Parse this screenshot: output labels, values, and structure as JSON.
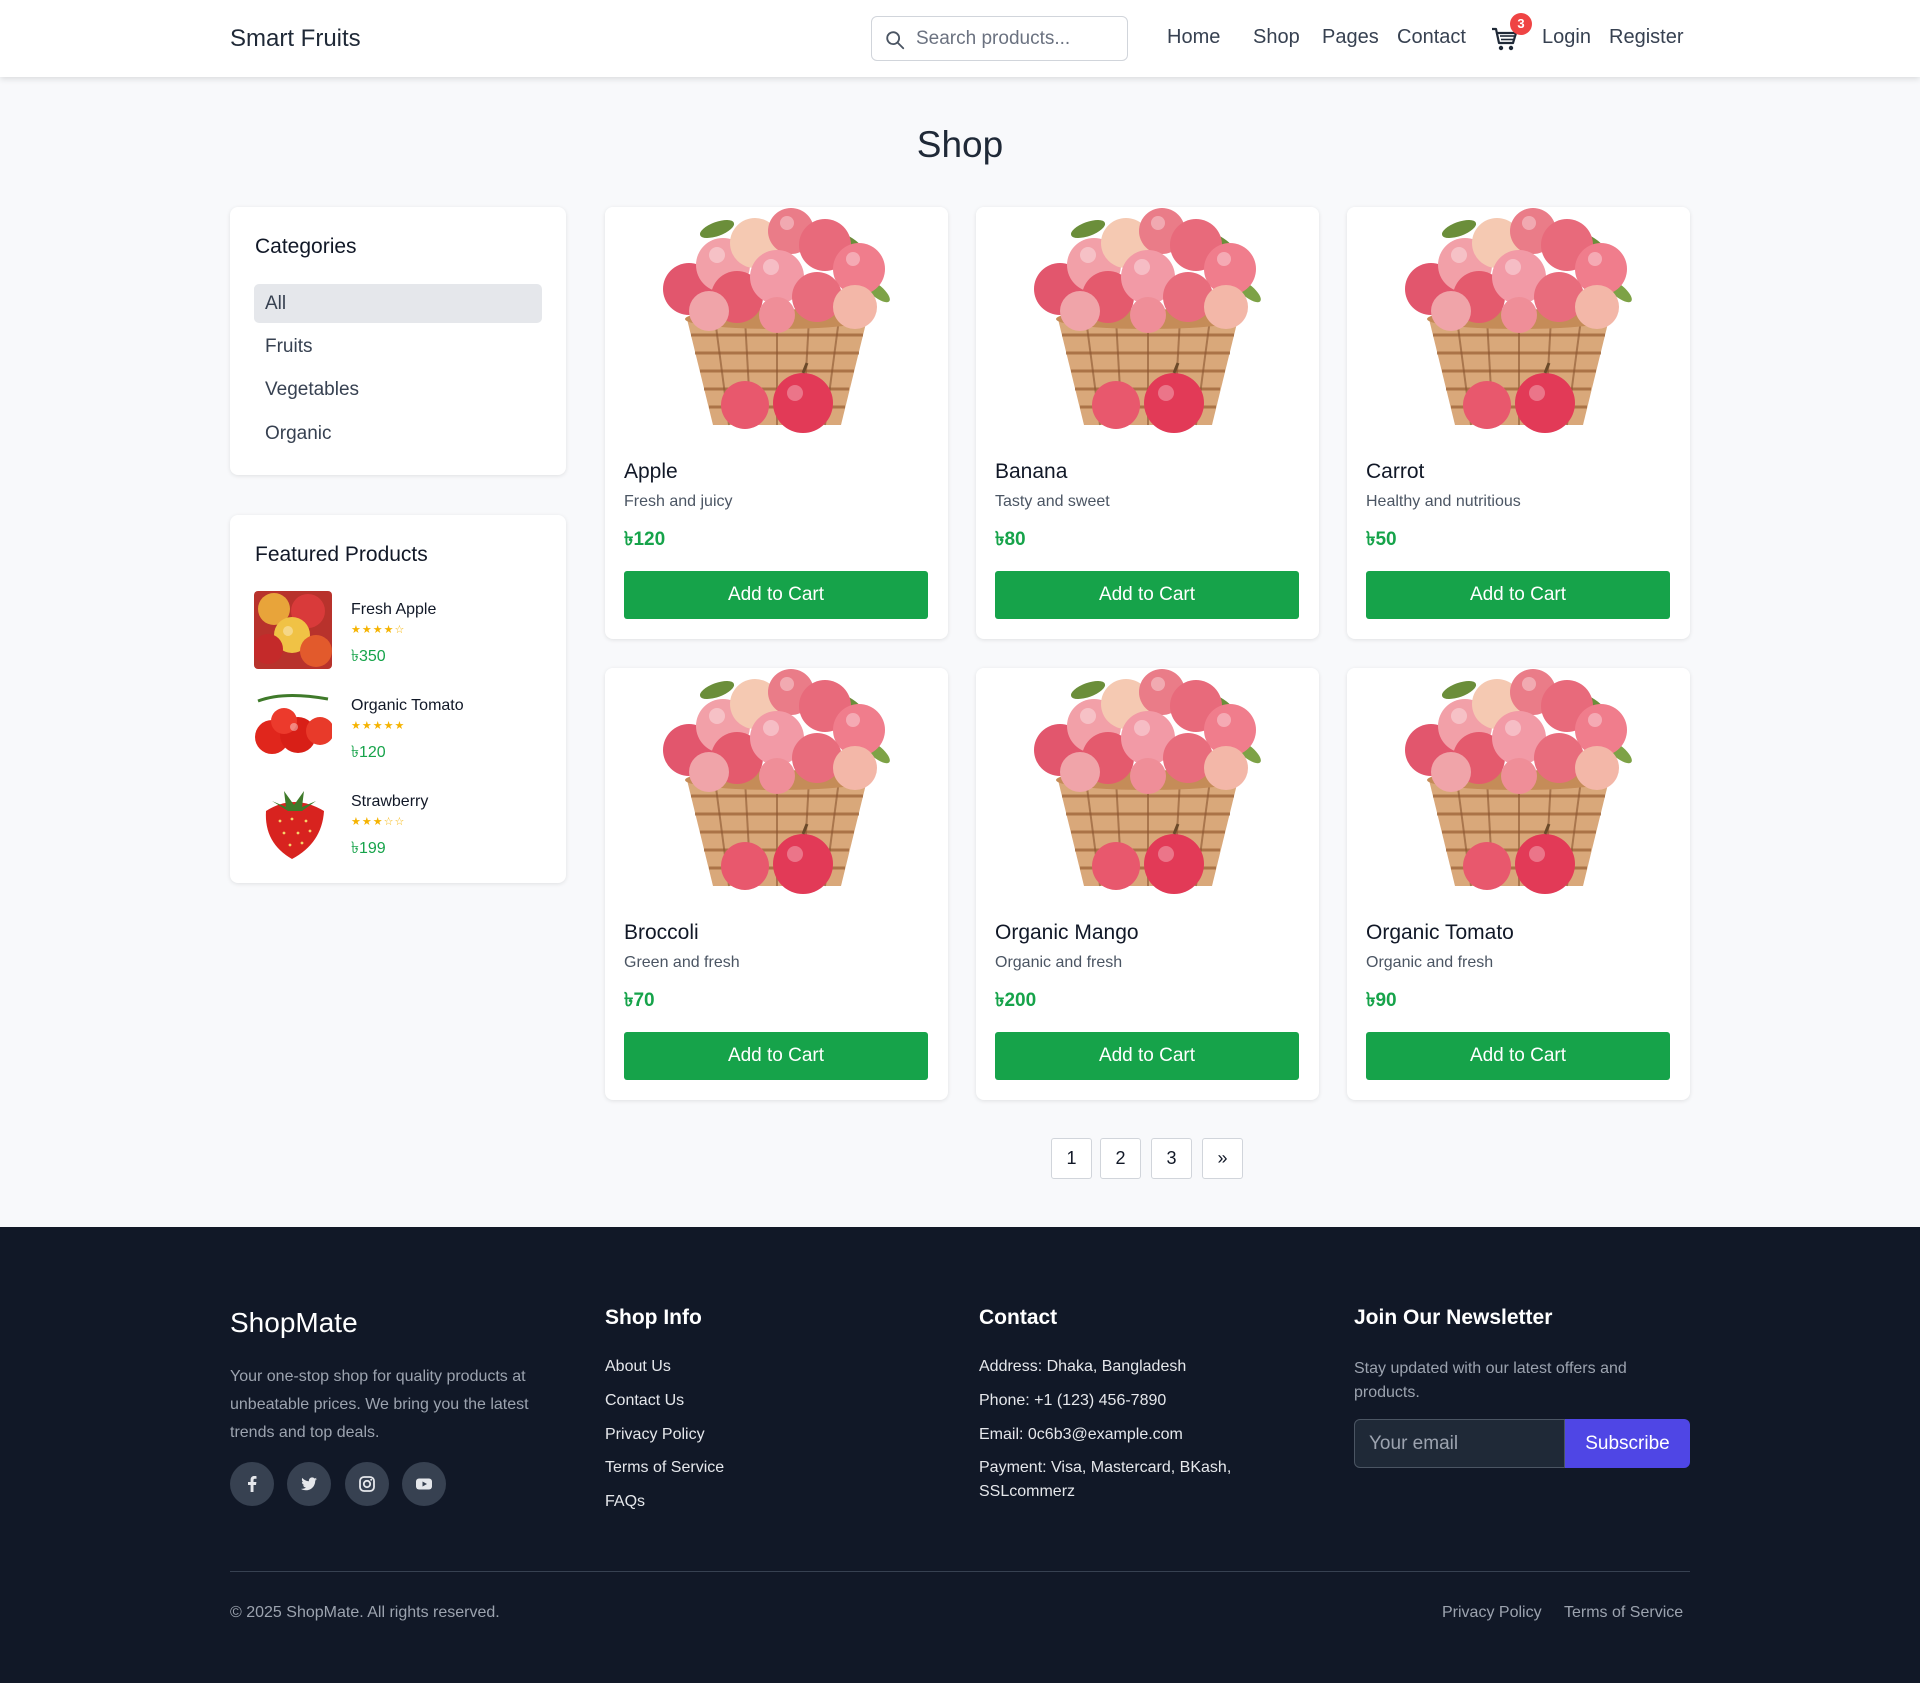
{
  "header": {
    "brand": "Smart Fruits",
    "search_placeholder": "Search products...",
    "nav": [
      "Home",
      "Shop",
      "Pages",
      "Contact"
    ],
    "cart_count": "3",
    "login": "Login",
    "register": "Register"
  },
  "page": {
    "title": "Shop"
  },
  "categories": {
    "title": "Categories",
    "items": [
      "All",
      "Fruits",
      "Vegetables",
      "Organic"
    ],
    "active": "All"
  },
  "featured": {
    "title": "Featured Products",
    "items": [
      {
        "name": "Fresh Apple",
        "rating": 4,
        "stars": "★★★★☆",
        "price": "৳350"
      },
      {
        "name": "Organic Tomato",
        "rating": 5,
        "stars": "★★★★★",
        "price": "৳120"
      },
      {
        "name": "Strawberry",
        "rating": 3,
        "stars": "★★★☆☆",
        "price": "৳199"
      }
    ]
  },
  "products": [
    {
      "name": "Apple",
      "desc": "Fresh and juicy",
      "price": "৳120",
      "button": "Add to Cart"
    },
    {
      "name": "Banana",
      "desc": "Tasty and sweet",
      "price": "৳80",
      "button": "Add to Cart"
    },
    {
      "name": "Carrot",
      "desc": "Healthy and nutritious",
      "price": "৳50",
      "button": "Add to Cart"
    },
    {
      "name": "Broccoli",
      "desc": "Green and fresh",
      "price": "৳70",
      "button": "Add to Cart"
    },
    {
      "name": "Organic Mango",
      "desc": "Organic and fresh",
      "price": "৳200",
      "button": "Add to Cart"
    },
    {
      "name": "Organic Tomato",
      "desc": "Organic and fresh",
      "price": "৳90",
      "button": "Add to Cart"
    }
  ],
  "pagination": [
    "1",
    "2",
    "3",
    "»"
  ],
  "footer": {
    "brand": "ShopMate",
    "about": "Your one-stop shop for quality products at unbeatable prices. We bring you the latest trends and top deals.",
    "social": [
      "facebook-icon",
      "twitter-icon",
      "instagram-icon",
      "youtube-icon"
    ],
    "shop_info": {
      "title": "Shop Info",
      "links": [
        "About Us",
        "Contact Us",
        "Privacy Policy",
        "Terms of Service",
        "FAQs"
      ]
    },
    "contact": {
      "title": "Contact",
      "address": "Address: Dhaka, Bangladesh",
      "phone": "Phone: +1 (123) 456-7890",
      "email": "Email: 0c6b3@example.com",
      "payment": "Payment: Visa, Mastercard, BKash, SSLcommerz"
    },
    "newsletter": {
      "title": "Join Our Newsletter",
      "text": "Stay updated with our latest offers and products.",
      "placeholder": "Your email",
      "button": "Subscribe"
    },
    "copyright": "© 2025 ShopMate. All rights reserved.",
    "bottom_links": [
      "Privacy Policy",
      "Terms of Service"
    ]
  },
  "colors": {
    "accent_green": "#16a34a",
    "badge_red": "#ef4444",
    "subscribe_indigo": "#4f46e5",
    "footer_bg": "#111827"
  }
}
